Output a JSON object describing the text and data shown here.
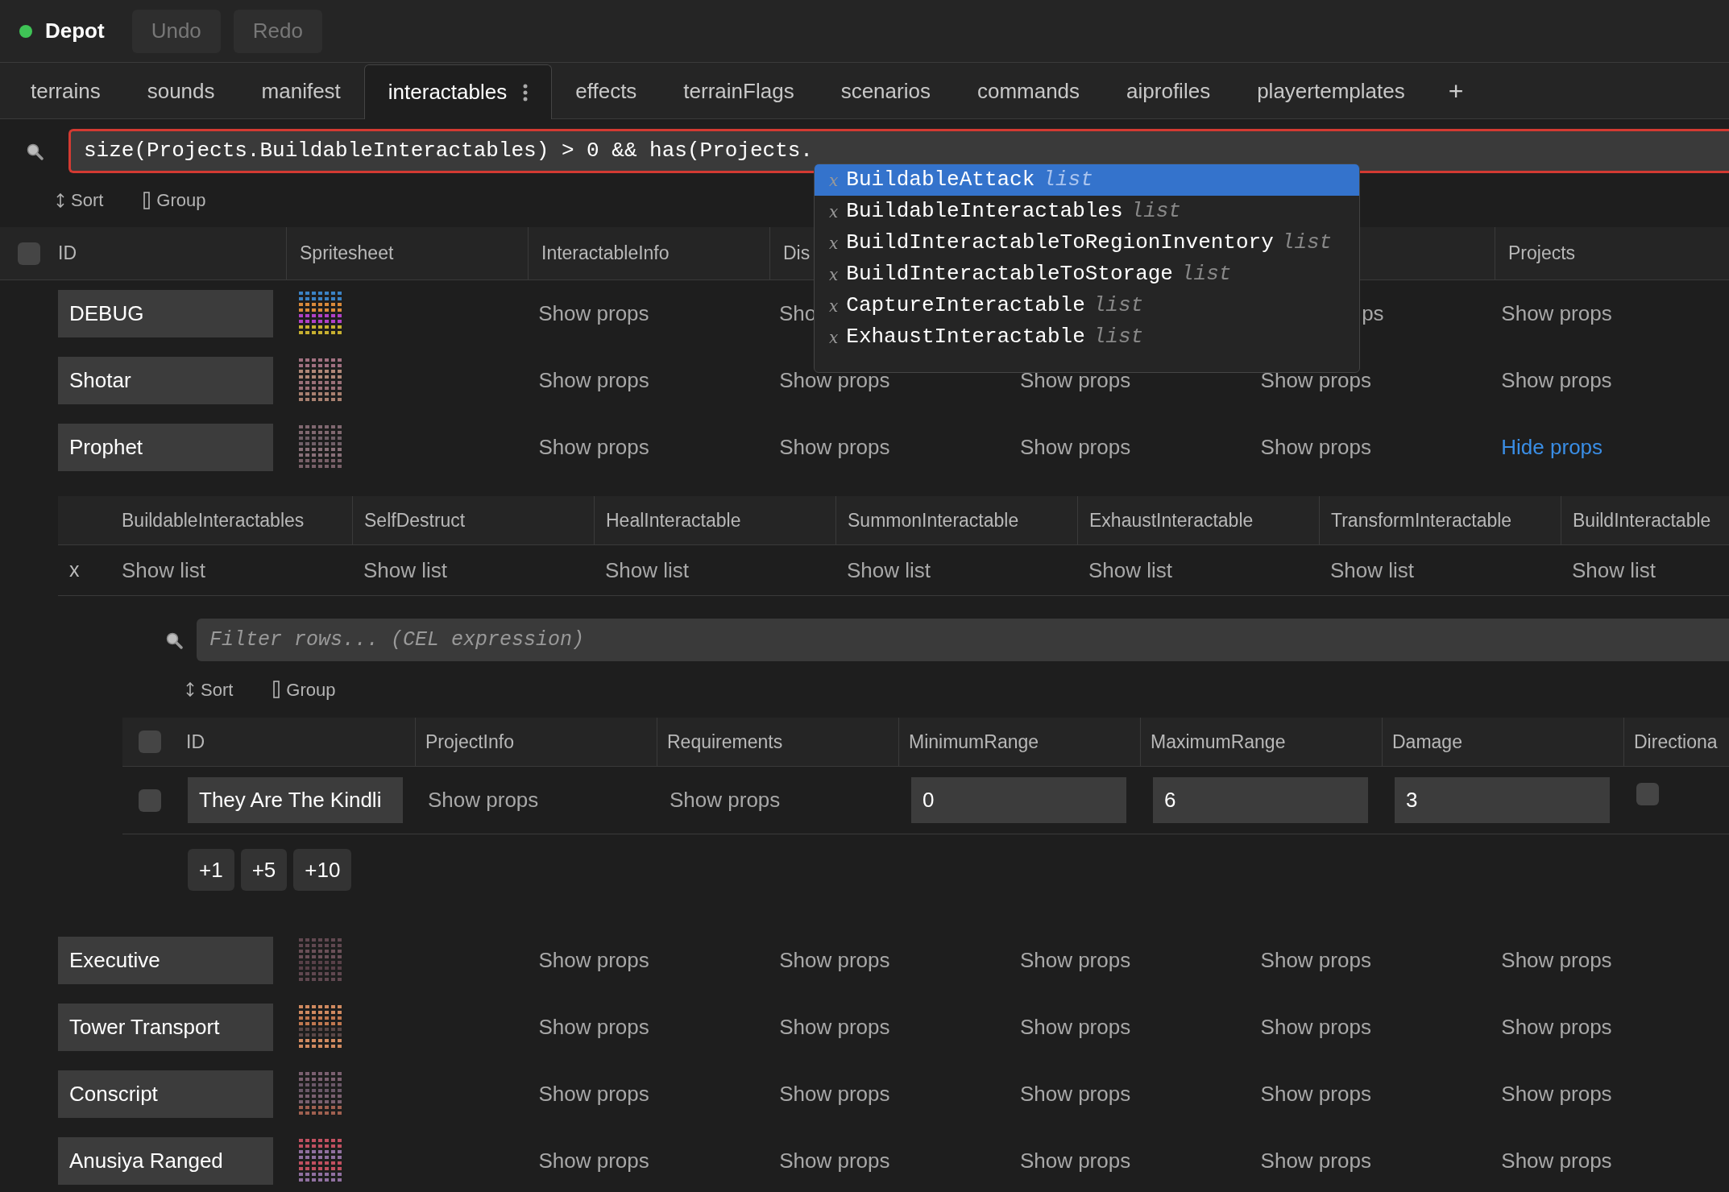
{
  "app": {
    "title": "Depot",
    "connected": true,
    "buttons": [
      {
        "label": "Undo",
        "disabled": true
      },
      {
        "label": "Redo",
        "disabled": true
      }
    ]
  },
  "tabs": [
    {
      "label": "terrains",
      "selected": false
    },
    {
      "label": "sounds",
      "selected": false
    },
    {
      "label": "manifest",
      "selected": false
    },
    {
      "label": "interactables",
      "selected": true
    },
    {
      "label": "effects",
      "selected": false
    },
    {
      "label": "terrainFlags",
      "selected": false
    },
    {
      "label": "scenarios",
      "selected": false
    },
    {
      "label": "commands",
      "selected": false
    },
    {
      "label": "aiprofiles",
      "selected": false
    },
    {
      "label": "playertemplates",
      "selected": false
    }
  ],
  "add_tab": "+",
  "filter": {
    "value": "size(Projects.BuildableInteractables) > 0 && has(Projects.",
    "invalid": true
  },
  "toolbar": [
    "Sort",
    "Group"
  ],
  "autocomplete": [
    {
      "icon": "x",
      "name": "BuildableAttack",
      "type": "list",
      "selected": true
    },
    {
      "icon": "x",
      "name": "BuildableInteractables",
      "type": "list",
      "selected": false
    },
    {
      "icon": "x",
      "name": "BuildInteractableToRegionInventory",
      "type": "list",
      "selected": false
    },
    {
      "icon": "x",
      "name": "BuildInteractableToStorage",
      "type": "list",
      "selected": false
    },
    {
      "icon": "x",
      "name": "CaptureInteractable",
      "type": "list",
      "selected": false
    },
    {
      "icon": "x",
      "name": "ExhaustInteractable",
      "type": "list",
      "selected": false
    }
  ],
  "table": {
    "checked": false,
    "columns": [
      "ID",
      "Spritesheet",
      "InteractableInfo",
      "Dis",
      null,
      null,
      "Projects"
    ],
    "rows": [
      {
        "cells": [
          "DEBUG",
          {
            "kind": "picture"
          },
          "Show props",
          "Sho",
          null,
          "ps",
          "Show props"
        ]
      },
      {
        "cells": [
          "Shotar",
          {
            "kind": "picture"
          },
          "Show props",
          "Show props",
          "Show props",
          "Show props",
          "Show props"
        ]
      },
      {
        "cells": [
          "Prophet",
          {
            "kind": "picture"
          },
          "Show props",
          "Show props",
          "Show props",
          "Show props",
          "Hide props"
        ],
        "expanded": true,
        "detail": {
          "checked": false,
          "columns": [
            "BuildableInteractables",
            "SelfDestruct",
            "HealInteractable",
            "SummonInteractable",
            "ExhaustInteractable",
            "TransformInteractable",
            "BuildInteractable"
          ],
          "row": {
            "remove": "x",
            "cells": [
              "Show list",
              "Show list",
              "Show list",
              "Show list",
              "Show list",
              "Show list",
              "Show list"
            ]
          },
          "filter": {
            "placeholder": "Filter rows... (CEL expression)"
          },
          "toolbar": [
            "Sort",
            "Group"
          ],
          "columns2": [
            "ID",
            "ProjectInfo",
            "Requirements",
            "MinimumRange",
            "MaximumRange",
            "Damage",
            "Directiona"
          ],
          "rows2": [
            {
              "id": "They Are The Kindli",
              "project_info": "Show props",
              "requirements": "Show props",
              "minimum_range": "0",
              "maximum_range": "6",
              "damage": "3",
              "directional": false,
              "checked": false
            }
          ],
          "add_buttons": [
            "+1",
            "+5",
            "+10"
          ]
        }
      },
      {
        "cells": [
          "Executive",
          {
            "kind": "picture"
          },
          "Show props",
          "Show props",
          "Show props",
          "Show props",
          "Show props"
        ]
      },
      {
        "cells": [
          "Tower Transport",
          {
            "kind": "picture"
          },
          "Show props",
          "Show props",
          "Show props",
          "Show props",
          "Show props"
        ]
      },
      {
        "cells": [
          "Conscript",
          {
            "kind": "picture"
          },
          "Show props",
          "Show props",
          "Show props",
          "Show props",
          "Show props"
        ]
      },
      {
        "cells": [
          "Anusiya Ranged",
          {
            "kind": "picture"
          },
          "Show props",
          "Show props",
          "Show props",
          "Show props",
          "Show props"
        ]
      }
    ]
  }
}
